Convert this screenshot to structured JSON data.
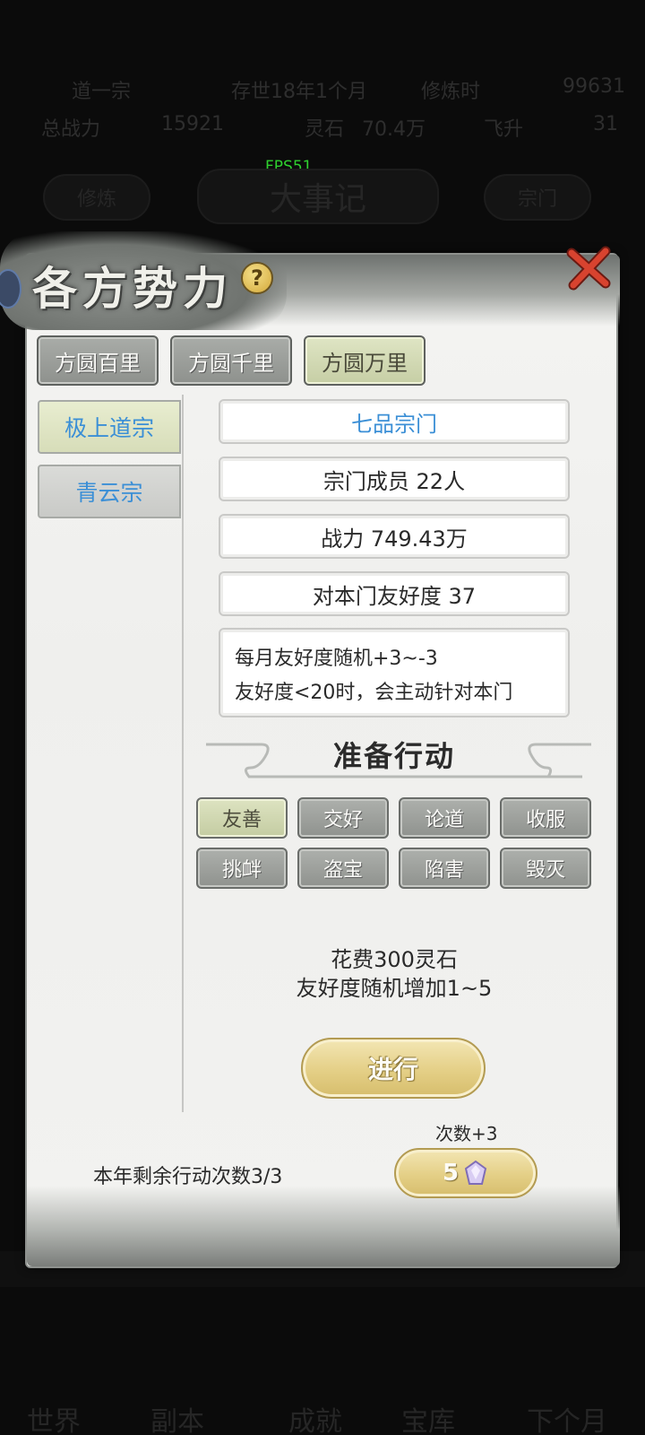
{
  "background": {
    "sect_name": "道一宗",
    "time": "存世18年1个月",
    "status": "修炼时",
    "number": "99631",
    "power_label": "总战力",
    "power_value": "15921",
    "resource_label": "灵石",
    "resource_value": "70.4万",
    "ascend": "飞升",
    "ascend_value": "31",
    "left_btn": "修炼",
    "center_btn": "大事记",
    "right_btn": "宗门",
    "fps": "FPS51",
    "bottom_items": [
      "世界",
      "副本",
      "成就",
      "宝库",
      "下个月"
    ]
  },
  "panel": {
    "title": "各方势力",
    "help": "?",
    "tabs": [
      "方圆百里",
      "方圆千里",
      "方圆万里"
    ],
    "active_tab": 2,
    "sects": [
      "极上道宗",
      "青云宗"
    ],
    "active_sect": 0,
    "info": {
      "rank": "七品宗门",
      "members": "宗门成员 22人",
      "power": "战力 749.43万",
      "friendship": "对本门友好度 37"
    },
    "desc_lines": [
      "每月友好度随机+3~-3",
      "友好度<20时，会主动针对本门"
    ],
    "prepare_title": "准备行动",
    "actions_row1": [
      "友善",
      "交好",
      "论道",
      "收服"
    ],
    "actions_row2": [
      "挑衅",
      "盗宝",
      "陷害",
      "毁灭"
    ],
    "active_action": "友善",
    "cost_line1": "花费300灵石",
    "cost_line2": "友好度随机增加1~5",
    "go_label": "进行",
    "times_label": "次数+3",
    "remain_label": "本年剩余行动次数3/3",
    "plus_cost": "5"
  },
  "colors": {
    "accent_blue": "#3b8fd6",
    "gold": "#e4cf86",
    "active_green": "#d7ddb9",
    "close_red": "#c83a2c"
  }
}
